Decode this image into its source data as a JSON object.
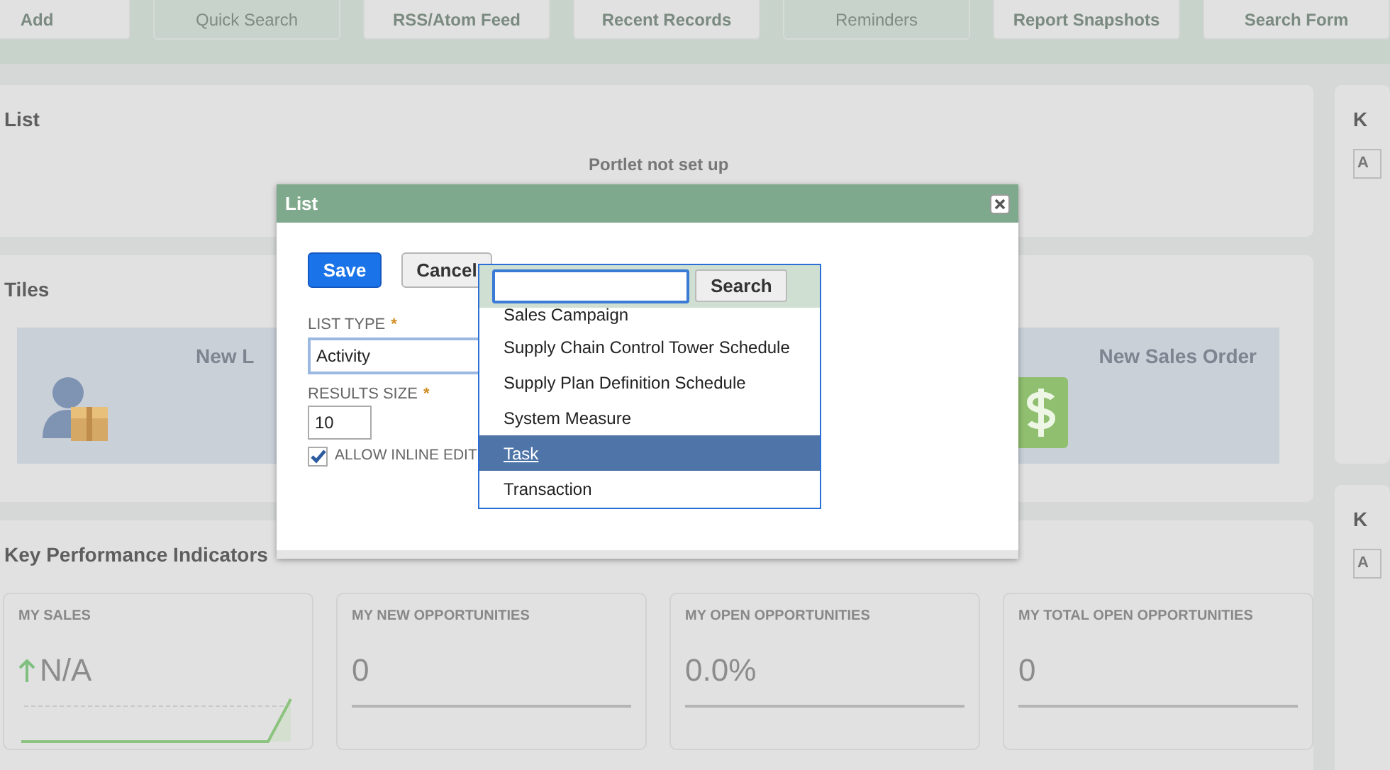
{
  "toolbar": [
    {
      "label": "Add",
      "disabled": false
    },
    {
      "label": "Quick Search",
      "disabled": true
    },
    {
      "label": "RSS/Atom Feed",
      "disabled": false
    },
    {
      "label": "Recent Records",
      "disabled": false
    },
    {
      "label": "Reminders",
      "disabled": true
    },
    {
      "label": "Report Snapshots",
      "disabled": false
    },
    {
      "label": "Search Form",
      "disabled": false
    }
  ],
  "portlets": [
    {
      "kind": "list",
      "title": "List",
      "message": "Portlet not set up"
    },
    {
      "kind": "tiles",
      "title": "Tiles",
      "tiles": [
        {
          "label": "New L"
        },
        {
          "label": "New Sales Order"
        }
      ]
    },
    {
      "kind": "kpi",
      "title": "Key Performance Indicators",
      "cards": [
        {
          "kind": "trend",
          "label": "MY SALES",
          "value": "N/A"
        },
        {
          "kind": "plain",
          "label": "MY NEW OPPORTUNITIES",
          "value": "0"
        },
        {
          "kind": "plain",
          "label": "MY OPEN OPPORTUNITIES",
          "value": "0.0%"
        },
        {
          "kind": "plain",
          "label": "MY TOTAL OPEN OPPORTUNITIES",
          "value": "0"
        }
      ]
    }
  ],
  "side_portlets": [
    {
      "title": "K",
      "field": "A"
    },
    {
      "title": "K",
      "field": "A"
    }
  ],
  "dialog": {
    "title": "List",
    "buttons": [
      "Save",
      "Cancel"
    ],
    "fields": [
      {
        "label": "LIST TYPE",
        "required_mark": "*",
        "value": "Activity"
      },
      {
        "label": "RESULTS SIZE",
        "required_mark": "*",
        "value": "10"
      }
    ],
    "checkbox": {
      "label": "ALLOW INLINE EDIT",
      "checked": true
    },
    "dropdown": {
      "search_button": "Search",
      "options": [
        {
          "label": "Sales Campaign",
          "selected": false
        },
        {
          "label": "Supply Chain Control Tower Schedule",
          "selected": false
        },
        {
          "label": "Supply Plan Definition Schedule",
          "selected": false
        },
        {
          "label": "System Measure",
          "selected": false
        },
        {
          "label": "Task",
          "selected": true
        },
        {
          "label": "Transaction",
          "selected": false
        }
      ]
    }
  }
}
